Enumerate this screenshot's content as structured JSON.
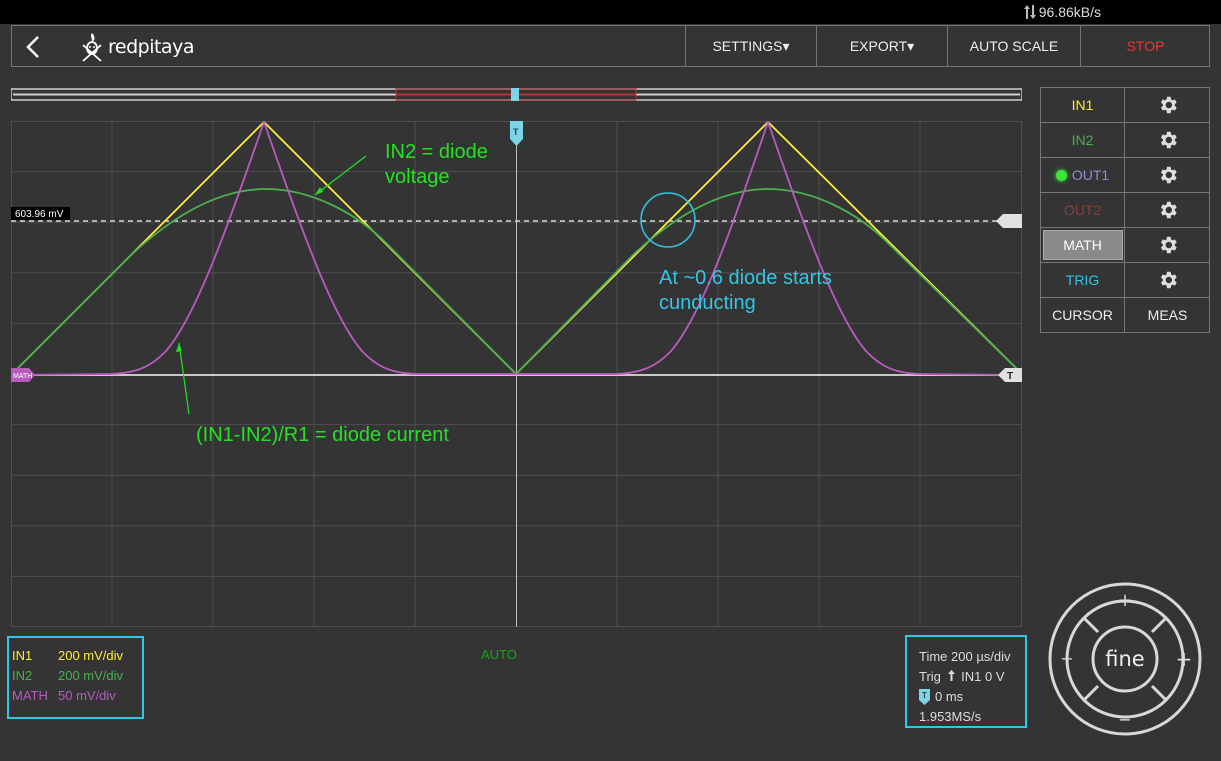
{
  "status": {
    "speed": "96.86kB/s"
  },
  "header": {
    "logo_text": "redpitaya",
    "menu": {
      "settings": "SETTINGS▾",
      "export": "EXPORT▾",
      "autoscale": "AUTO SCALE",
      "stop": "STOP"
    }
  },
  "channels": [
    {
      "label": "IN1",
      "color": "#ffeb3b"
    },
    {
      "label": "IN2",
      "color": "#4caf50"
    },
    {
      "label": "OUT1",
      "color": "#8f8fd8"
    },
    {
      "label": "OUT2",
      "color": "#8a3b3b"
    },
    {
      "label": "MATH",
      "color": "#ffffff"
    },
    {
      "label": "TRIG",
      "color": "#2fc7e6"
    }
  ],
  "tools": {
    "cursor": "CURSOR",
    "meas": "MEAS"
  },
  "plot": {
    "cursor_value": "603.96 mV",
    "math_marker": "MATH",
    "trigger_marker": "T",
    "annotations": {
      "in2_line1": "IN2 = diode",
      "in2_line2": "voltage",
      "cond_line1": "At ~0.6 diode starts",
      "cond_line2": "cunducting",
      "current": "(IN1-IN2)/R1 = diode current"
    }
  },
  "scales": [
    {
      "name": "IN1",
      "value": "200 mV/div",
      "color": "#ffeb3b"
    },
    {
      "name": "IN2",
      "value": "200 mV/div",
      "color": "#4caf50"
    },
    {
      "name": "MATH",
      "value": "50 mV/div",
      "color": "#b75bbd"
    }
  ],
  "trigger_mode": "AUTO",
  "timebase": {
    "time": "Time 200 µs/div",
    "trig_prefix": "Trig",
    "trig_source": "IN1 0 V",
    "delay": "0 ms",
    "sample_rate": "1.953MS/s"
  },
  "wheel": {
    "center": "fine",
    "plus": "+",
    "minus": "−"
  },
  "colors": {
    "in1": "#ffeb3b",
    "in2": "#4caf50",
    "math": "#b75bbd",
    "accent": "#2fc7e6",
    "annotation": "#22e322",
    "annotation_blue": "#2fc7e6",
    "stop": "#e53935"
  }
}
